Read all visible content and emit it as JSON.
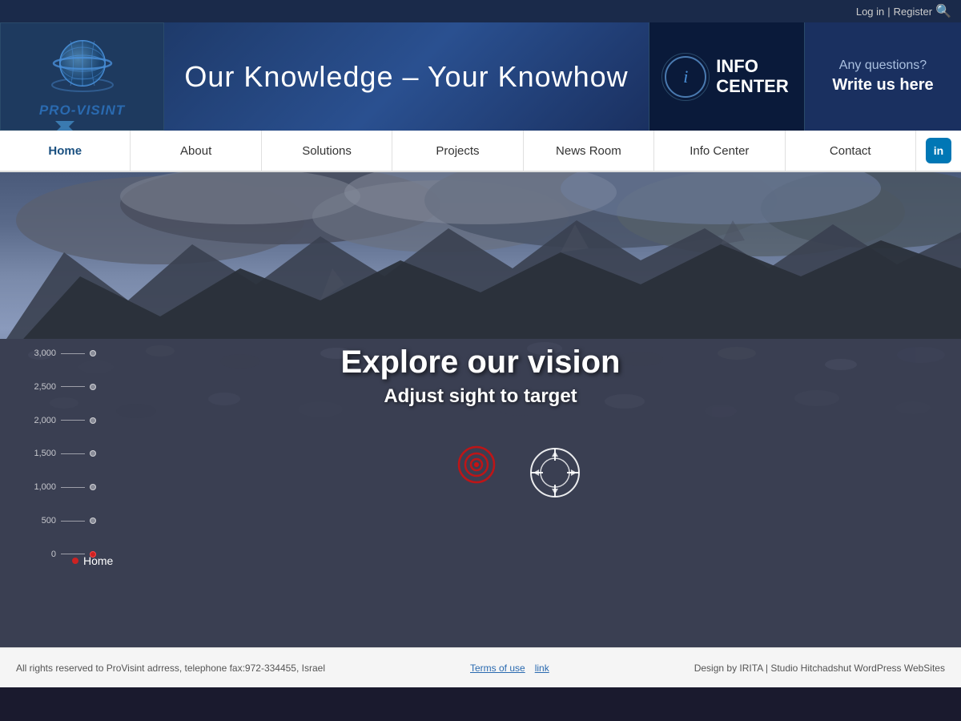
{
  "topbar": {
    "login": "Log in",
    "separator": "|",
    "register": "Register"
  },
  "header": {
    "logo_text_pro": "PRO",
    "logo_text_visint": "-VISINT",
    "tagline": "Our Knowledge – Your Knowhow",
    "info_center_label": "INFO\nCENTER",
    "contact_question": "Any questions?",
    "contact_cta": "Write us here"
  },
  "nav": {
    "items": [
      {
        "label": "Home",
        "id": "home",
        "active": true
      },
      {
        "label": "About",
        "id": "about",
        "active": false
      },
      {
        "label": "Solutions",
        "id": "solutions",
        "active": false
      },
      {
        "label": "Projects",
        "id": "projects",
        "active": false
      },
      {
        "label": "News Room",
        "id": "newsroom",
        "active": false
      },
      {
        "label": "Info Center",
        "id": "infocenter",
        "active": false
      },
      {
        "label": "Contact",
        "id": "contact",
        "active": false
      }
    ]
  },
  "hero": {
    "title": "Explore our vision",
    "subtitle": "Adjust sight to target",
    "scale": [
      {
        "value": "3,000",
        "dot": false
      },
      {
        "value": "2,500",
        "dot": false
      },
      {
        "value": "2,000",
        "dot": false
      },
      {
        "value": "1,500",
        "dot": false
      },
      {
        "value": "1,000",
        "dot": false
      },
      {
        "value": "500",
        "dot": false
      },
      {
        "value": "0",
        "dot": true
      }
    ],
    "breadcrumb": "Home"
  },
  "footer": {
    "copyright": "All rights reserved to ProVisint adrress, telephone fax:972-334455, Israel",
    "terms": "Terms of use",
    "link": "link",
    "design": "Design by IRITA | Studio Hitchadshut WordPress WebSites"
  }
}
